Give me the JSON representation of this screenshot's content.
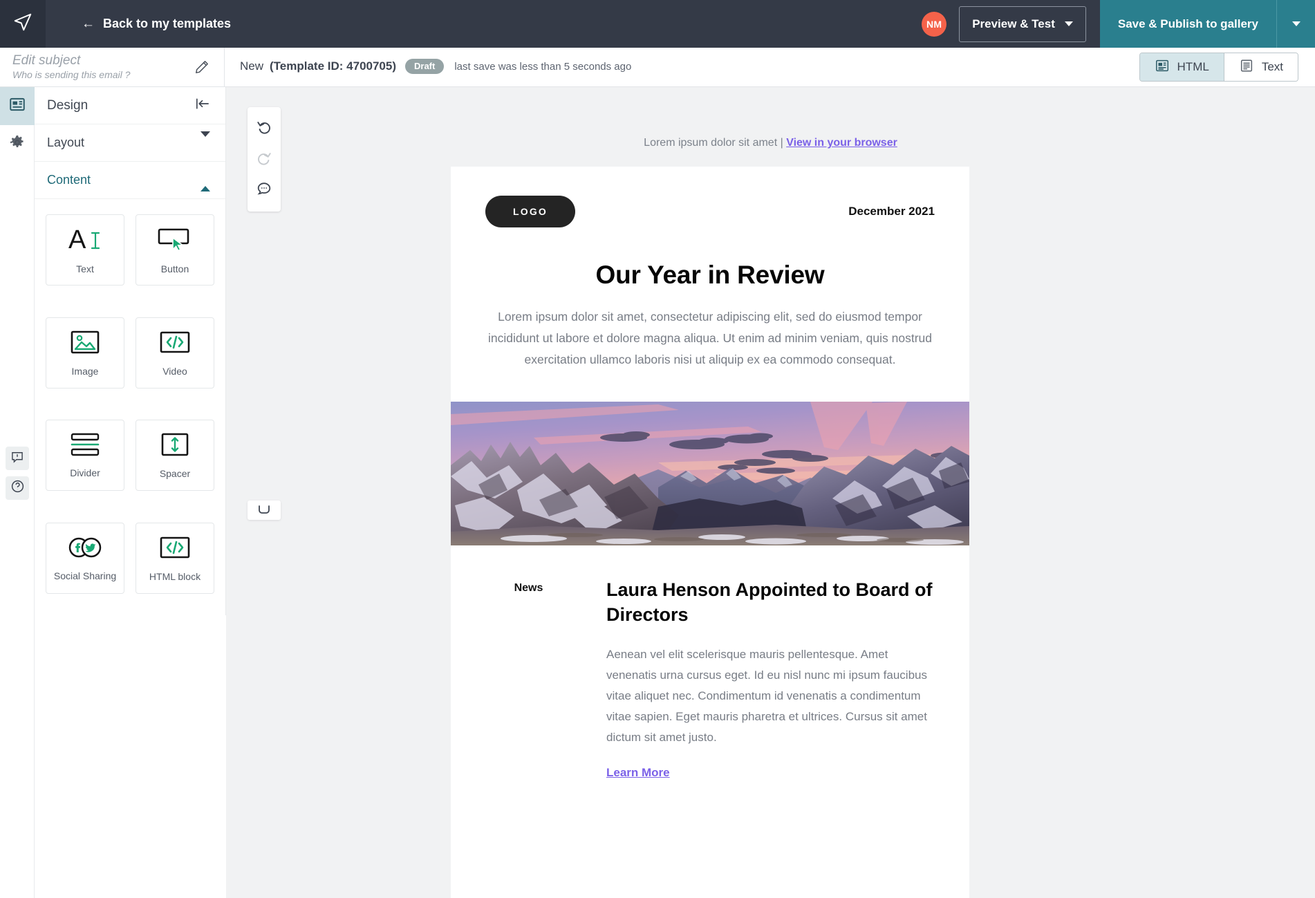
{
  "topnav": {
    "app_icon": "paper-plane-icon",
    "back_label": "Back to my templates",
    "avatar_initials": "NM",
    "preview_label": "Preview & Test",
    "publish_label": "Save & Publish to gallery"
  },
  "subheader": {
    "subject_title": "Edit subject",
    "subject_sub": "Who is sending this email ?",
    "template_name": "New",
    "template_id_label": "(Template ID: 4700705)",
    "status_badge": "Draft",
    "save_note": "last save was less than 5 seconds ago",
    "view_html": "HTML",
    "view_text": "Text"
  },
  "panel": {
    "title": "Design",
    "collapse_icon": "collapse-left-icon",
    "sections": [
      {
        "label": "Layout",
        "open": false
      },
      {
        "label": "Content",
        "open": true
      }
    ],
    "blocks": [
      {
        "label": "Text",
        "icon": "text-block-icon"
      },
      {
        "label": "Button",
        "icon": "button-block-icon"
      },
      {
        "label": "Image",
        "icon": "image-block-icon"
      },
      {
        "label": "Video",
        "icon": "video-block-icon"
      },
      {
        "label": "Divider",
        "icon": "divider-block-icon"
      },
      {
        "label": "Spacer",
        "icon": "spacer-block-icon"
      },
      {
        "label": "Social Sharing",
        "icon": "social-sharing-block-icon"
      },
      {
        "label": "HTML block",
        "icon": "html-block-icon"
      }
    ]
  },
  "rail": {
    "items": [
      {
        "name": "design-tab",
        "icon": "design-panel-icon",
        "active": true
      },
      {
        "name": "settings-tab",
        "icon": "gear-icon",
        "active": false
      }
    ],
    "bottom": [
      {
        "name": "feedback-button",
        "icon": "feedback-icon"
      },
      {
        "name": "help-button",
        "icon": "question-mark-icon"
      }
    ]
  },
  "history_toolbar": {
    "undo_icon": "undo-icon",
    "redo_icon": "redo-icon",
    "comment_icon": "comment-icon"
  },
  "email": {
    "preheader_text": "Lorem ipsum dolor sit amet |",
    "preheader_link": "View in your browser",
    "logo_text": "LOGO",
    "date": "December 2021",
    "headline": "Our Year in Review",
    "lead": "Lorem ipsum dolor sit amet, consectetur adipiscing elit, sed do eiusmod tempor incididunt ut labore et dolore magna aliqua. Ut enim ad minim veniam, quis nostrud exercitation ullamco laboris nisi ut aliquip ex ea commodo consequat.",
    "hero_alt": "snow-capped mountain range at pink sunset",
    "article_tag": "News",
    "article_title": "Laura Henson Appointed to Board of Directors",
    "article_body": "Aenean vel elit scelerisque mauris pellentesque. Amet venenatis urna cursus eget. Id eu nisl nunc mi ipsum faucibus vitae aliquet nec. Condimentum id venenatis a condimentum vitae sapien. Eget mauris pharetra et ultrices. Cursus sit amet dictum sit amet justo.",
    "article_link": "Learn More"
  },
  "colors": {
    "topnav_bg": "#343a47",
    "publish_teal": "#2a7f8e",
    "avatar_orange": "#f4624a",
    "accent_green": "#19a974",
    "link_purple": "#7b61e8",
    "active_rail": "#cfe0e5",
    "canvas_bg": "#f1f2f3"
  }
}
